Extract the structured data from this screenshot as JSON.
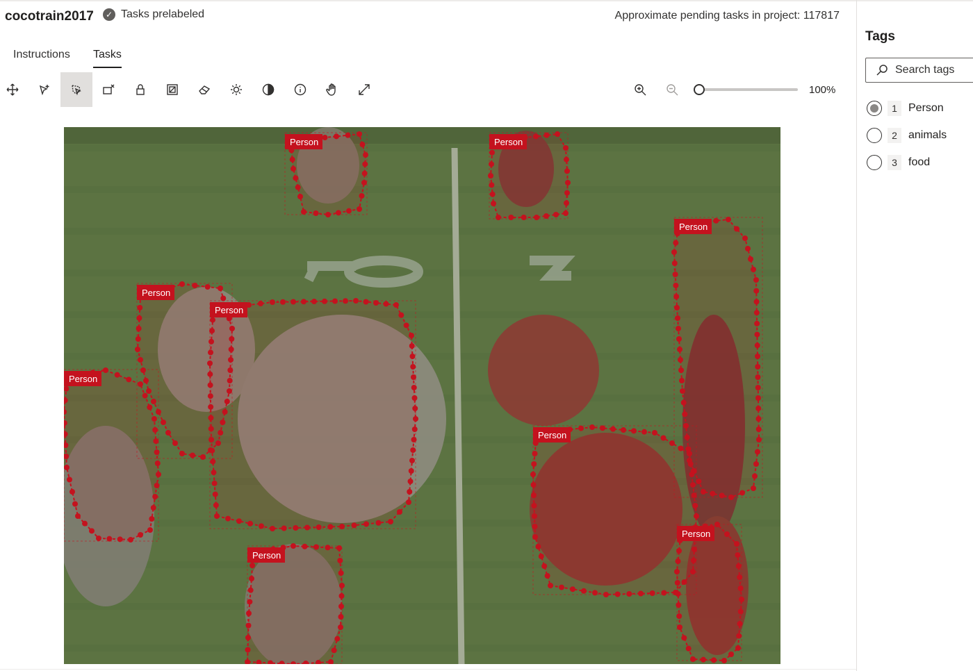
{
  "header": {
    "project_title": "cocotrain2017",
    "status_text": "Tasks prelabeled",
    "pending_text": "Approximate pending tasks in project: 117817"
  },
  "tabs": [
    {
      "label": "Instructions",
      "active": false
    },
    {
      "label": "Tasks",
      "active": true
    }
  ],
  "toolbar": {
    "tools": [
      {
        "icon": "move-icon",
        "active": false
      },
      {
        "icon": "add-point-icon",
        "active": false
      },
      {
        "icon": "polygon-select-icon",
        "active": true
      },
      {
        "icon": "remove-region-icon",
        "active": false
      },
      {
        "icon": "lock-icon",
        "active": false
      },
      {
        "icon": "region-overlap-icon",
        "active": false
      },
      {
        "icon": "eraser-icon",
        "active": false
      },
      {
        "icon": "brightness-icon",
        "active": false
      },
      {
        "icon": "contrast-icon",
        "active": false
      },
      {
        "icon": "info-icon",
        "active": false
      },
      {
        "icon": "pan-hand-icon",
        "active": false
      },
      {
        "icon": "fit-expand-icon",
        "active": false
      }
    ],
    "zoom_value": 1.0,
    "zoom_label": "100%"
  },
  "canvas": {
    "region_label": "Person",
    "region_count": 10,
    "colors": {
      "region": "#c4121e",
      "field": "#5c7342"
    }
  },
  "tags_panel": {
    "title": "Tags",
    "search_placeholder": "Search tags",
    "tags": [
      {
        "key": "1",
        "name": "Person",
        "selected": true
      },
      {
        "key": "2",
        "name": "animals",
        "selected": false
      },
      {
        "key": "3",
        "name": "food",
        "selected": false
      }
    ]
  }
}
